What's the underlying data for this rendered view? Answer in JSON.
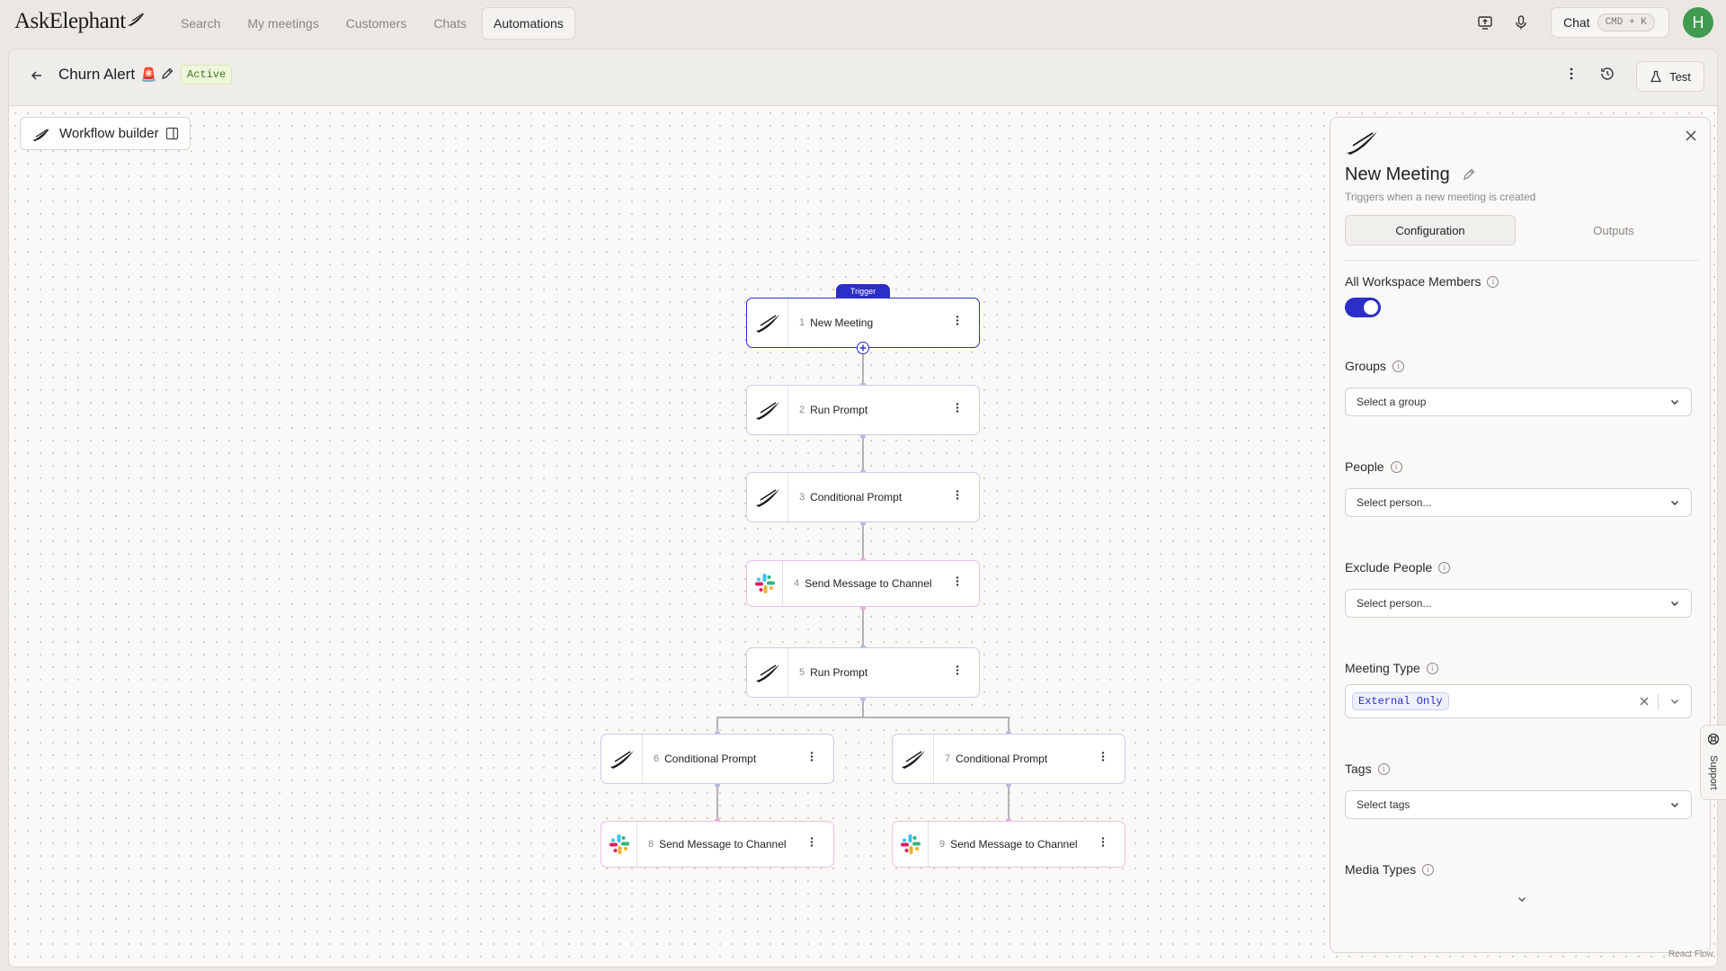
{
  "app": {
    "logo_text": "AskElephant",
    "nav": [
      "Search",
      "My meetings",
      "Customers",
      "Chats",
      "Automations"
    ],
    "active_nav": "Automations",
    "chat_label": "Chat",
    "chat_shortcut": "CMD + K",
    "avatar_initial": "H"
  },
  "workflow": {
    "title": "Churn Alert",
    "title_emoji": "🚨",
    "status": "Active",
    "test_label": "Test"
  },
  "canvas": {
    "builder_label": "Workflow builder",
    "trigger_tag": "Trigger",
    "nodes": [
      {
        "num": "1",
        "label": "New Meeting",
        "kind": "elephant"
      },
      {
        "num": "2",
        "label": "Run Prompt",
        "kind": "elephant"
      },
      {
        "num": "3",
        "label": "Conditional Prompt",
        "kind": "elephant"
      },
      {
        "num": "4",
        "label": "Send Message to Channel",
        "kind": "slack"
      },
      {
        "num": "5",
        "label": "Run Prompt",
        "kind": "elephant"
      },
      {
        "num": "6",
        "label": "Conditional Prompt",
        "kind": "elephant"
      },
      {
        "num": "7",
        "label": "Conditional Prompt",
        "kind": "elephant"
      },
      {
        "num": "8",
        "label": "Send Message to Channel",
        "kind": "slack"
      },
      {
        "num": "9",
        "label": "Send Message to Channel",
        "kind": "slack"
      }
    ],
    "attribution": "React Flow"
  },
  "panel": {
    "title": "New Meeting",
    "subtitle": "Triggers when a new meeting is created",
    "tabs": [
      "Configuration",
      "Outputs"
    ],
    "active_tab": "Configuration",
    "all_members_label": "All Workspace Members",
    "all_members_on": true,
    "groups_label": "Groups",
    "groups_placeholder": "Select a group",
    "people_label": "People",
    "people_placeholder": "Select person...",
    "exclude_label": "Exclude People",
    "exclude_placeholder": "Select person...",
    "meeting_type_label": "Meeting Type",
    "meeting_type_value": "External Only",
    "tags_label": "Tags",
    "tags_placeholder": "Select tags",
    "media_types_label": "Media Types"
  },
  "support_label": "Support",
  "colors": {
    "accent": "#2c2ec9",
    "active_badge": "#3f7a1f",
    "avatar": "#3f9b4f",
    "slack_border": "#ebbfe6"
  }
}
